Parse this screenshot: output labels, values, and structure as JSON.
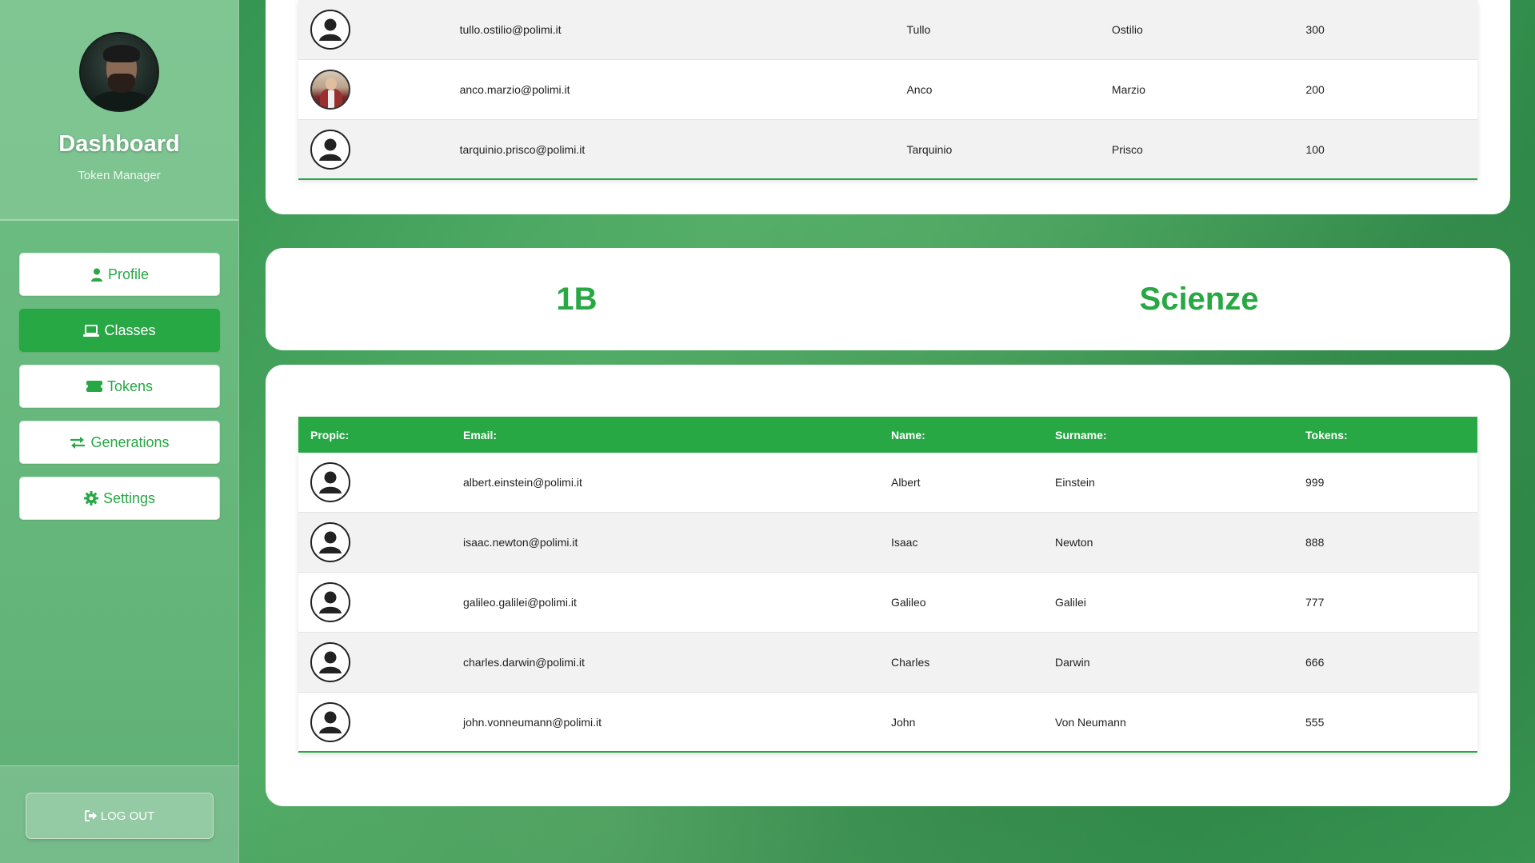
{
  "sidebar": {
    "title": "Dashboard",
    "subtitle": "Token Manager",
    "nav": [
      {
        "label": "Profile",
        "icon": "user-icon",
        "active": false
      },
      {
        "label": "Classes",
        "icon": "laptop-icon",
        "active": true
      },
      {
        "label": "Tokens",
        "icon": "ticket-icon",
        "active": false
      },
      {
        "label": "Generations",
        "icon": "exchange-icon",
        "active": false
      },
      {
        "label": "Settings",
        "icon": "gear-icon",
        "active": false
      }
    ],
    "logout_label": "LOG OUT"
  },
  "top_table": {
    "rows": [
      {
        "email": "tullo.ostilio@polimi.it",
        "name": "Tullo",
        "surname": "Ostilio",
        "tokens": "300",
        "pic": "default-avatar"
      },
      {
        "email": "anco.marzio@polimi.it",
        "name": "Anco",
        "surname": "Marzio",
        "tokens": "200",
        "pic": "photo"
      },
      {
        "email": "tarquinio.prisco@polimi.it",
        "name": "Tarquinio",
        "surname": "Prisco",
        "tokens": "100",
        "pic": "default-avatar"
      }
    ]
  },
  "class_header": {
    "class_name": "1B",
    "subject": "Scienze"
  },
  "main_table": {
    "headers": {
      "propic": "Propic:",
      "email": "Email:",
      "name": "Name:",
      "surname": "Surname:",
      "tokens": "Tokens:"
    },
    "rows": [
      {
        "email": "albert.einstein@polimi.it",
        "name": "Albert",
        "surname": "Einstein",
        "tokens": "999"
      },
      {
        "email": "isaac.newton@polimi.it",
        "name": "Isaac",
        "surname": "Newton",
        "tokens": "888"
      },
      {
        "email": "galileo.galilei@polimi.it",
        "name": "Galileo",
        "surname": "Galilei",
        "tokens": "777"
      },
      {
        "email": "charles.darwin@polimi.it",
        "name": "Charles",
        "surname": "Darwin",
        "tokens": "666"
      },
      {
        "email": "john.vonneumann@polimi.it",
        "name": "John",
        "surname": "Von Neumann",
        "tokens": "555"
      }
    ]
  },
  "colors": {
    "accent": "#28a745",
    "sidebar": "#6fbf85"
  }
}
